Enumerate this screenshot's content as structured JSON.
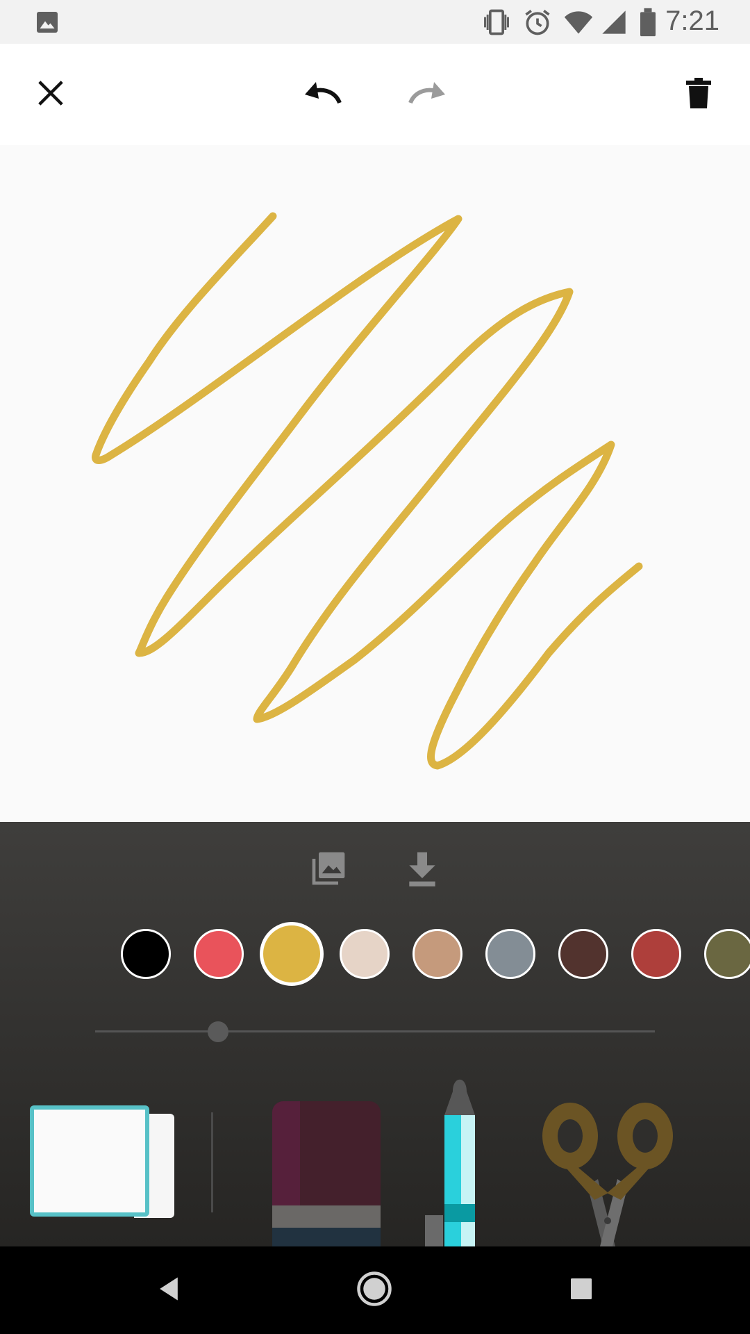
{
  "status_bar": {
    "time": "7:21",
    "left_icon": "image-notification-icon",
    "icons": [
      "vibrate-icon",
      "alarm-icon",
      "wifi-icon",
      "cell-signal-icon",
      "battery-icon"
    ]
  },
  "toolbar": {
    "close_icon": "close-icon",
    "undo_icon": "undo-icon",
    "redo_icon": "redo-icon",
    "delete_icon": "trash-icon"
  },
  "canvas": {
    "stroke_color": "#dcb443",
    "background": "#fafafa"
  },
  "panel": {
    "actions": [
      "gallery-icon",
      "download-icon"
    ],
    "colors": [
      {
        "hex": "#000000",
        "selected": false
      },
      {
        "hex": "#e9535b",
        "selected": false
      },
      {
        "hex": "#dcb443",
        "selected": true
      },
      {
        "hex": "#e6d4c7",
        "selected": false
      },
      {
        "hex": "#c59a7c",
        "selected": false
      },
      {
        "hex": "#838d95",
        "selected": false
      },
      {
        "hex": "#52332e",
        "selected": false
      },
      {
        "hex": "#ae3f3b",
        "selected": false
      },
      {
        "hex": "#6a6741",
        "selected": false
      }
    ],
    "brush_size_fraction": 0.22,
    "tools": [
      "eraser-tool",
      "marker-tool",
      "pen-tool",
      "scissors-tool"
    ],
    "selected_tool": "eraser-tool"
  },
  "nav_bar": {
    "buttons": [
      "back-icon",
      "home-icon",
      "recents-icon"
    ]
  }
}
